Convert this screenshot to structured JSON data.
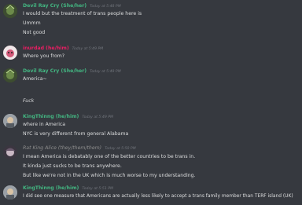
{
  "messages": [
    {
      "author": "Devil Ray Cry (She/her)",
      "author_color": "#43b581",
      "timestamp": "Today at 5:48 PM",
      "lines": [
        "I would but the treatment of trans people here is",
        "Ummm",
        "Not good"
      ]
    },
    {
      "author": "inurdad (he/him)",
      "author_color": "#e91e63",
      "timestamp": "Today at 5:49 PM",
      "lines": [
        "Where you from?"
      ]
    },
    {
      "author": "Devil Ray Cry (She/her)",
      "author_color": "#43b581",
      "timestamp": "Today at 5:49 PM",
      "lines": [
        "America~",
        "Fuck"
      ]
    },
    {
      "author": "KingThinng (he/him)",
      "author_color": "#43b581",
      "timestamp": "Today at 5:49 PM",
      "lines": [
        "where in America",
        "NYC is very different from general Alabama"
      ]
    },
    {
      "author": "Rat King Alice (they/them/them)",
      "author_color": "#8e8e8e",
      "timestamp": "Today at 5:50 PM",
      "lines": [
        "I mean America is debatably one of the better countries to be trans in.",
        "It kinda just sucks to be trans anywhere.",
        "But like we're not in the UK which is much worse to my understanding."
      ]
    },
    {
      "author": "KingThinng (he/him)",
      "author_color": "#43b581",
      "timestamp": "Today at 5:51 PM",
      "lines": [
        "I did see one measure that Americans are actually less likely to accept a trans family member than TERF island (UK)"
      ]
    }
  ]
}
